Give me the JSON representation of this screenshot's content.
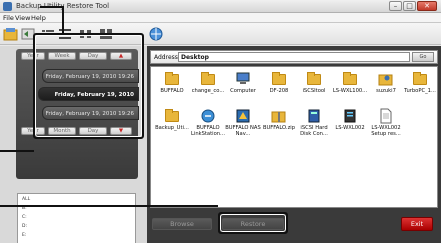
{
  "window": {
    "title": "Backup Utility Restore Tool",
    "buttons": {
      "minimize": "–",
      "maximize": "□",
      "close": "✕"
    }
  },
  "menu": [
    "File",
    "View",
    "Help"
  ],
  "toolbar": {
    "icons": [
      "backup-icon",
      "restore-icon",
      "view-details-icon",
      "view-list-icon",
      "view-small-icon",
      "view-large-icon",
      "connect-icon"
    ]
  },
  "left": {
    "top_buttons": [
      "Year",
      "Week",
      "Day",
      "▲"
    ],
    "bottom_buttons": [
      "Year",
      "Month",
      "Day",
      "▼"
    ],
    "dates": [
      "Friday, February 19, 2010 19:26",
      "Friday, February 19, 2010 19:26",
      "Friday, February 19, 2010 19:26"
    ],
    "preview_lines": [
      "ALL",
      "B:",
      "C:",
      "D:",
      "E:"
    ]
  },
  "right": {
    "address_label": "Address",
    "address_value": "Desktop",
    "go_label": "Go",
    "files": [
      {
        "name": "BUFFALO",
        "icon": "folder"
      },
      {
        "name": "change_co...",
        "icon": "folder"
      },
      {
        "name": "Computer",
        "icon": "computer"
      },
      {
        "name": "DF-208",
        "icon": "folder"
      },
      {
        "name": "iSCSItool",
        "icon": "folder"
      },
      {
        "name": "LS-WXL100...",
        "icon": "folder"
      },
      {
        "name": "suzuki7",
        "icon": "user"
      },
      {
        "name": "TurboPC_1...",
        "icon": "folder"
      },
      {
        "name": "Backup_Uti...",
        "icon": "folder"
      },
      {
        "name": "BUFFALO LinkStation...",
        "icon": "app"
      },
      {
        "name": "BUFFALO NAS Nav...",
        "icon": "app"
      },
      {
        "name": "BUFFALO.zip",
        "icon": "zip"
      },
      {
        "name": "iSCSI Hard Disk Con...",
        "icon": "app"
      },
      {
        "name": "LS-WXL002",
        "icon": "app"
      },
      {
        "name": "LS-WXL002 Setup res...",
        "icon": "doc"
      }
    ],
    "browse_label": "Browse",
    "restore_label": "Restore",
    "exit_label": "Exit"
  },
  "colors": {
    "accent_exit": "#cc1a1a",
    "panel_dark": "#3a3a3a",
    "folder": "#e8b63b"
  }
}
